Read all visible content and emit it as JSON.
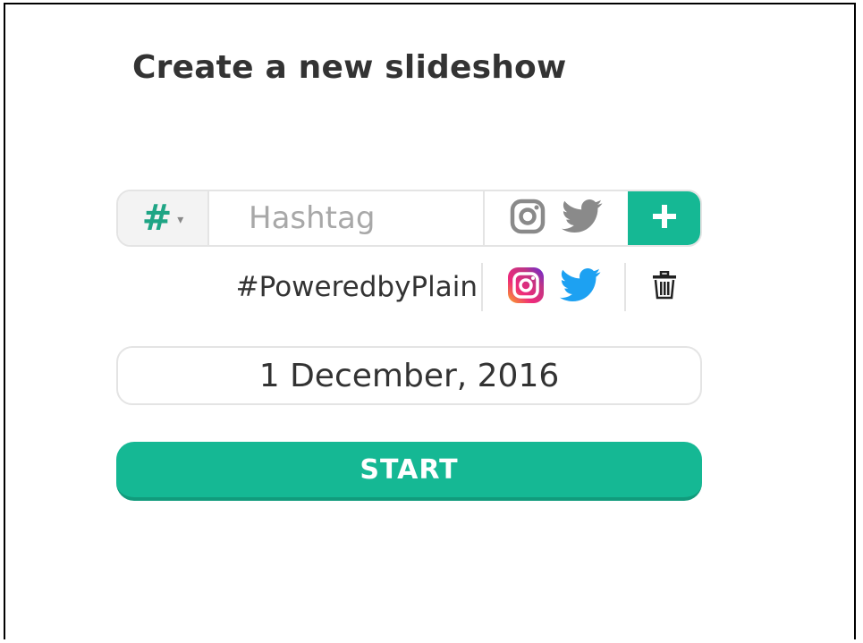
{
  "form": {
    "title": "Create a new slideshow",
    "hashtag_input": {
      "prefix_symbol": "#",
      "prefix_caret": "▾",
      "placeholder": "Hashtag",
      "value": "",
      "source_icons": [
        "instagram-icon",
        "twitter-icon"
      ],
      "add_icon": "plus-icon"
    },
    "hashtags": [
      {
        "label": "#PoweredbyPlain",
        "sources": [
          "instagram-icon",
          "twitter-icon"
        ],
        "delete_icon": "trash-icon"
      }
    ],
    "date": "1 December, 2016",
    "start_label": "START"
  },
  "colors": {
    "accent": "#15b894",
    "hash_symbol": "#1fa585",
    "text": "#333333",
    "placeholder": "#a8a8a8",
    "border": "#e4e4e4",
    "twitter_blue": "#1da1f2",
    "icon_gray": "#8a8a8a"
  }
}
